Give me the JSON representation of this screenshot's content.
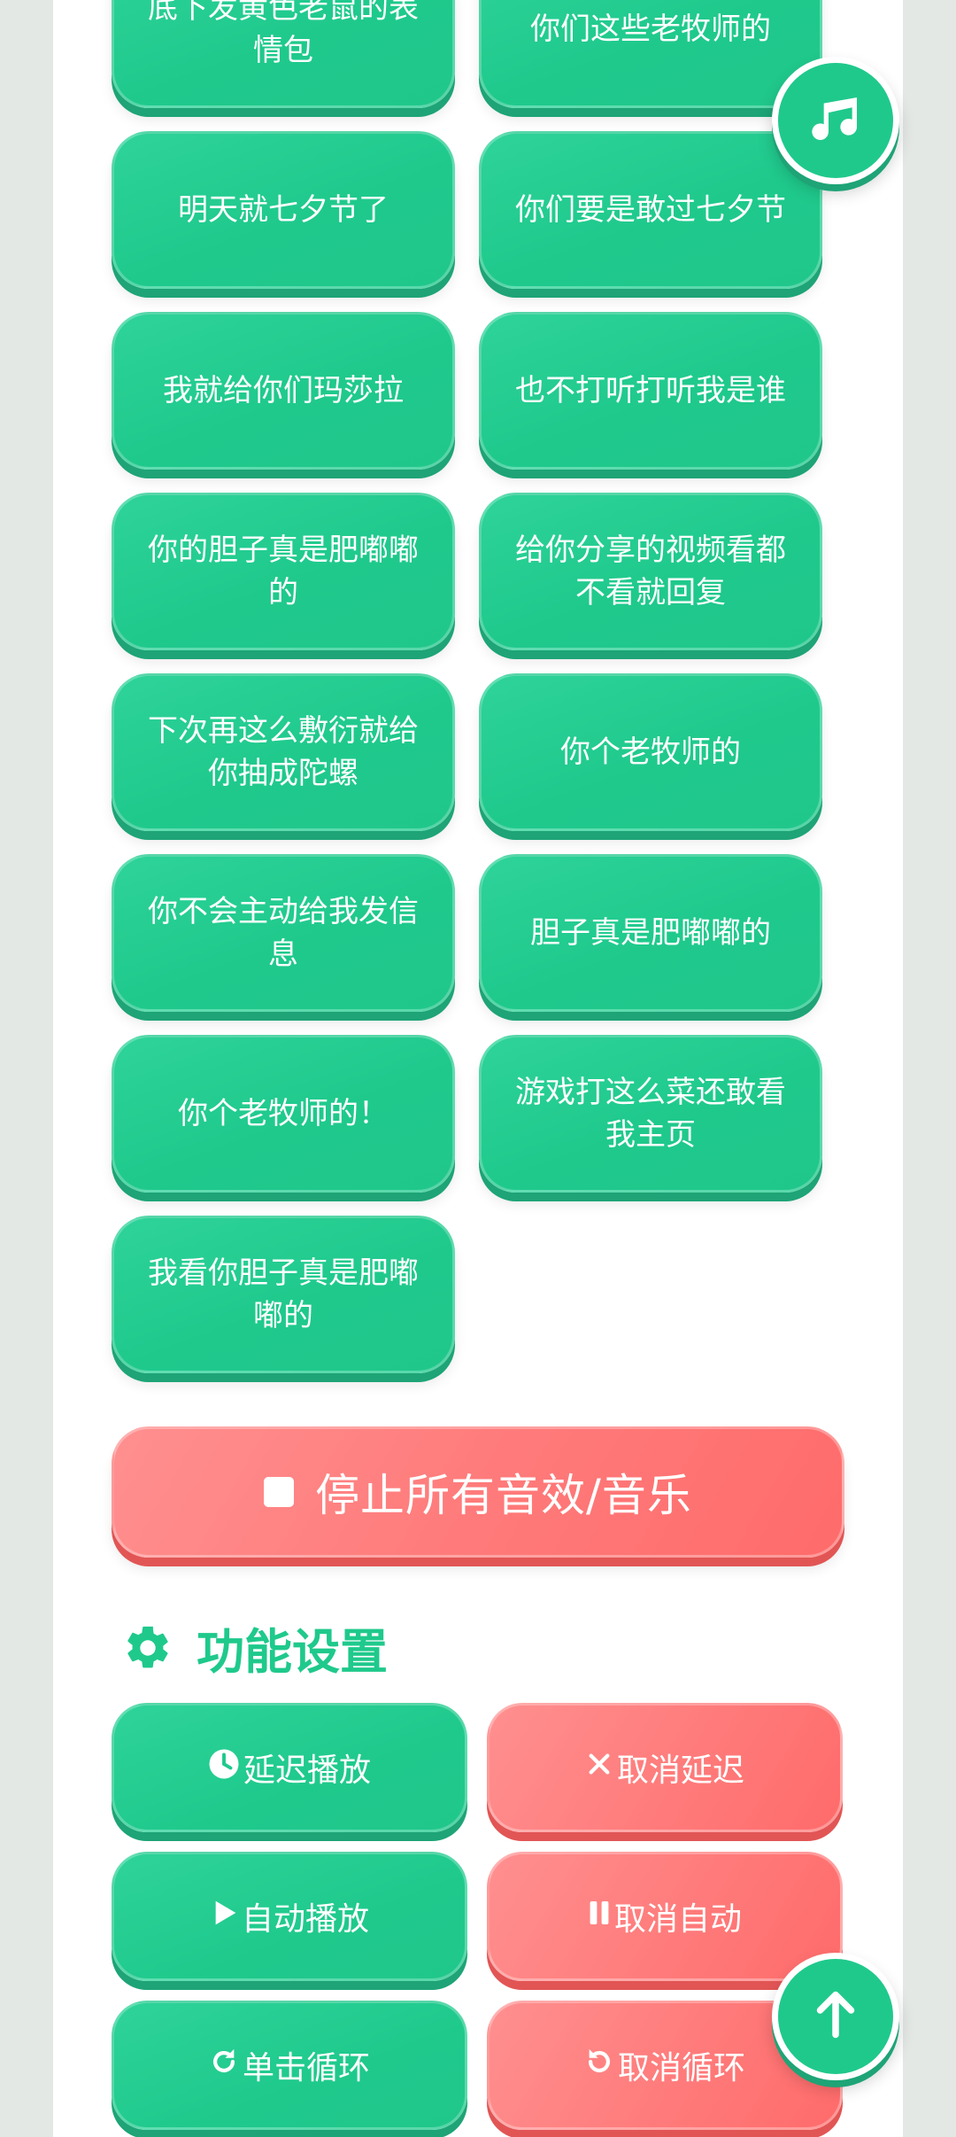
{
  "sound_buttons": [
    {
      "label": "底下发黄色老鼠的表情包"
    },
    {
      "label": "你们这些老牧师的"
    },
    {
      "label": "明天就七夕节了"
    },
    {
      "label": "你们要是敢过七夕节"
    },
    {
      "label": "我就给你们玛莎拉"
    },
    {
      "label": "也不打听打听我是谁"
    },
    {
      "label": "你的胆子真是肥嘟嘟的"
    },
    {
      "label": "给你分享的视频看都不看就回复"
    },
    {
      "label": "下次再这么敷衍就给你抽成陀螺"
    },
    {
      "label": "你个老牧师的"
    },
    {
      "label": "你不会主动给我发信息"
    },
    {
      "label": "胆子真是肥嘟嘟的"
    },
    {
      "label": "你个老牧师的！"
    },
    {
      "label": "游戏打这么菜还敢看我主页"
    },
    {
      "label": "我看你胆子真是肥嘟嘟的"
    }
  ],
  "stop_button": {
    "label": "停止所有音效/音乐",
    "icon": "stop-square-icon"
  },
  "settings": {
    "title": "功能设置",
    "icon": "gear-icon",
    "buttons": {
      "delay_play": "延迟播放",
      "cancel_delay": "取消延迟",
      "auto_play": "自动播放",
      "cancel_auto": "取消自动",
      "loop_single": "单击循环",
      "cancel_loop": "取消循环"
    }
  },
  "fab": {
    "music_icon": "music-note-icon",
    "top_icon": "arrow-up-icon"
  },
  "colors": {
    "green": "#1fc98c",
    "green_shadow": "#1ea476",
    "red": "#ff7b7b",
    "red_shadow": "#e25555",
    "background": "#e3e8e5"
  }
}
